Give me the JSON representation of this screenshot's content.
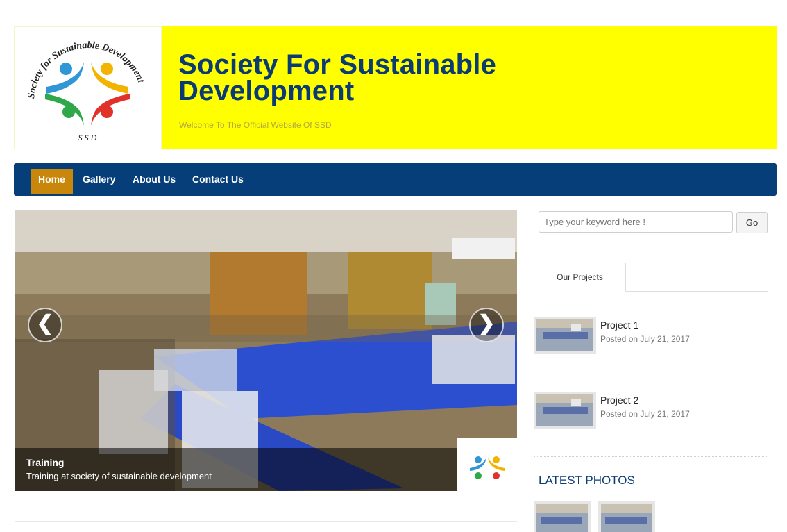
{
  "header": {
    "logo_ring_text": "Society for Sustainable Development",
    "logo_initials": "S S D",
    "title_line1": "Society For Sustainable",
    "title_line2": "Development",
    "tagline": "Welcome To The Official Website Of SSD"
  },
  "nav": {
    "items": [
      {
        "label": "Home",
        "active": true
      },
      {
        "label": "Gallery"
      },
      {
        "label": "About Us"
      },
      {
        "label": "Contact Us"
      }
    ]
  },
  "slider": {
    "caption_title": "Training",
    "caption_text": "Training at society of sustainable development",
    "prev_icon": "chevron-left-icon",
    "next_icon": "chevron-right-icon",
    "prev_glyph": "❮",
    "next_glyph": "❯"
  },
  "sidebar": {
    "search": {
      "placeholder": "Type your keyword here !",
      "button": "Go"
    },
    "tab_label": "Our Projects",
    "projects": [
      {
        "title": "Project 1",
        "date": "Posted on July 21, 2017"
      },
      {
        "title": "Project 2",
        "date": "Posted on July 21, 2017"
      }
    ],
    "latest_photos_title": "LATEST PHOTOS"
  },
  "colors": {
    "brand_blue": "#053e78",
    "banner_yellow": "#ffff00",
    "nav_active": "#c8860a"
  }
}
